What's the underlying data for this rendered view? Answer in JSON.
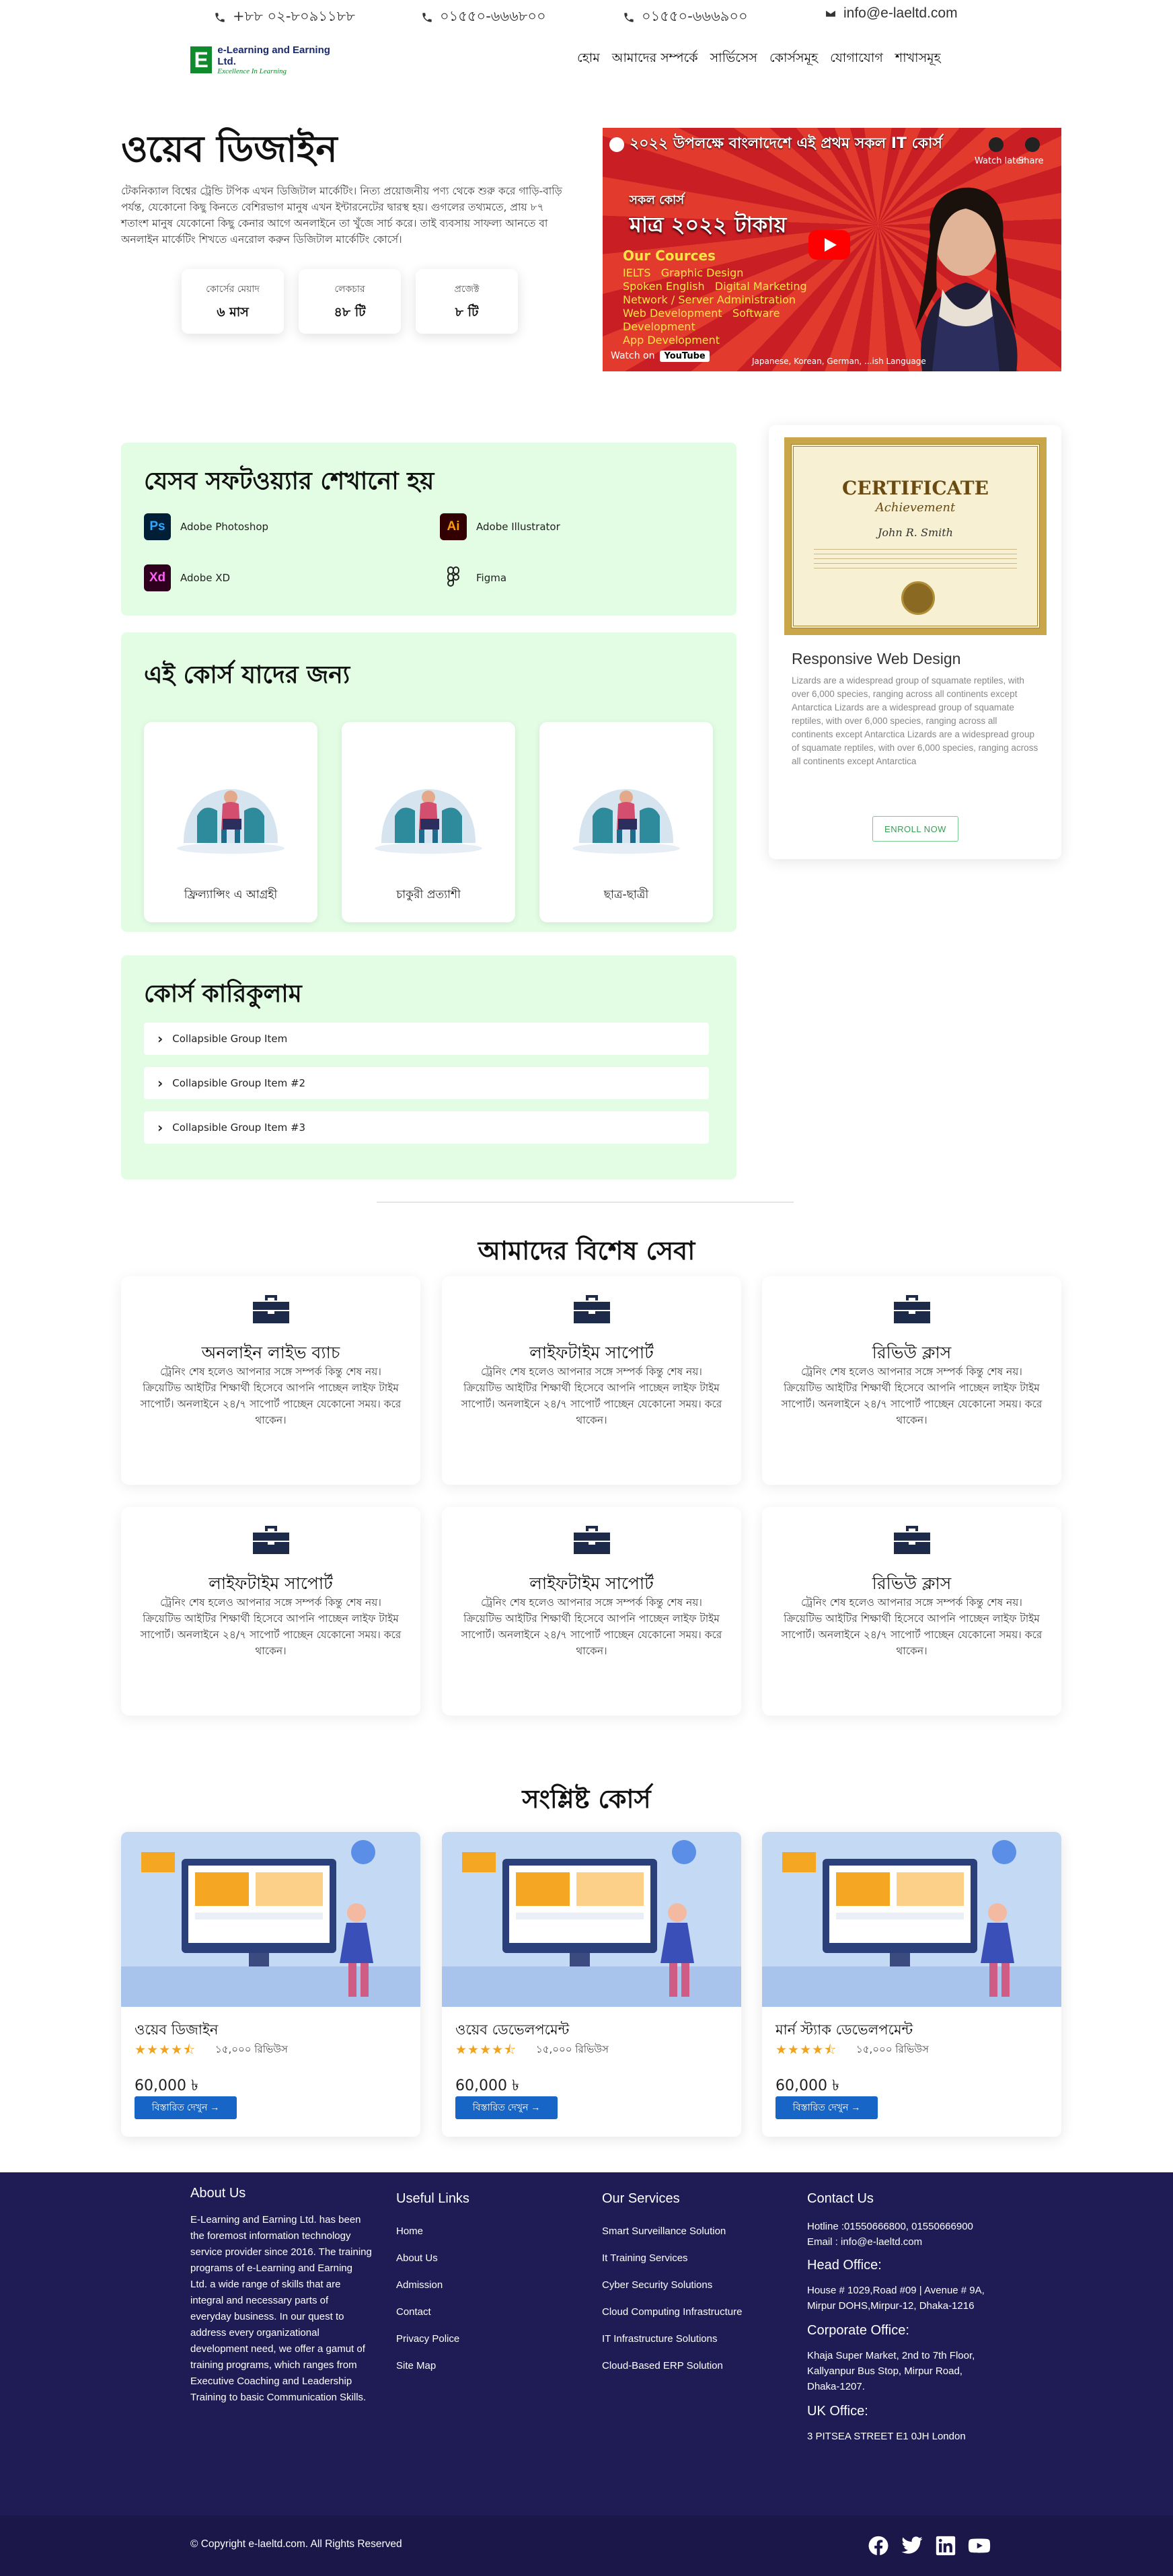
{
  "topbar": {
    "phone1": "+৮৮ ০২-৮০৯১১৮৮",
    "phone2": "০১৫৫০-৬৬৬৮০০",
    "phone3": "০১৫৫০-৬৬৬৯০০",
    "email": "info@e-laeltd.com"
  },
  "logo": {
    "mark": "E",
    "name": "e-Learning and Earning Ltd.",
    "tagline": "Excellence In Learning"
  },
  "nav": [
    "হোম",
    "আমাদের সম্পর্কে",
    "সার্ভিসেস",
    "কোর্সসমূহ",
    "যোগাযোগ",
    "শাখাসমূহ"
  ],
  "hero": {
    "title": "ওয়েব ডিজাইন",
    "description": "টেকনিক্যাল বিশ্বের ট্রেন্ডি টপিক এখন ডিজিটাল মার্কেটিং। নিত্য প্রয়োজনীয় পণ্য থেকে শুরু করে গাড়ি-বাড়ি পর্যন্ত, যেকোনো কিছু কিনতে বেশিরভাগ মানুষ এখন ইন্টারনেটের দ্বারস্থ হয়। গুগলের তথ্যমতে, প্রায় ৮৭ শতাংশ মানুষ যেকোনো কিছু কেনার আগে অনলাইনে তা খুঁজে সার্চ করে। তাই ব্যবসায় সাফল্য আনতে বা অনলাইন মার্কেটিং শিখতে এনরোল করুন ডিজিটাল মার্কেটিং কোর্সে।",
    "stats": [
      {
        "label": "কোর্সের মেয়াদ",
        "value": "৬ মাস"
      },
      {
        "label": "লেকচার",
        "value": "৪৮ টি"
      },
      {
        "label": "প্রজেক্ট",
        "value": "৮ টি"
      }
    ]
  },
  "video": {
    "title": "২০২২ উপলক্ষে বাংলাদেশে এই প্রথম সকল IT কোর্স",
    "watch_later": "Watch later",
    "share": "Share",
    "offer_line1": "সকল কোর্স",
    "offer_line2": "মাত্র ২০২২ টাকায়",
    "courses_heading": "Our Cources",
    "course_list": [
      "IELTS",
      "Graphic Design",
      "Spoken English",
      "Digital Marketing",
      "Network / Server Administration",
      "Web Development",
      "Software Development",
      "App Development"
    ],
    "watch_on": "Watch on",
    "youtube": "YouTube",
    "languages": "Japanese, Korean, German, ...ish Language"
  },
  "software": {
    "title": "যেসব সফটওয়্যার শেখানো হয়",
    "items": [
      {
        "icon": "Ps",
        "name": "Adobe Photoshop",
        "color": "#001e36"
      },
      {
        "icon": "Ai",
        "name": "Adobe Illustrator",
        "color": "#330000"
      },
      {
        "icon": "Xd",
        "name": "Adobe XD",
        "color": "#2e001e"
      },
      {
        "icon": "figma",
        "name": "Figma",
        "color": "#222222"
      }
    ]
  },
  "audience": {
    "title": "এই কোর্স যাদের জন্য",
    "items": [
      "ফ্রিল্যান্সিং এ আগ্রহী",
      "চাকুরী প্রত্যাশী",
      "ছাত্র-ছাত্রী"
    ]
  },
  "curriculum": {
    "title": "কোর্স কারিকুলাম",
    "items": [
      "Collapsible Group Item",
      "Collapsible Group Item #2",
      "Collapsible Group Item #3"
    ]
  },
  "certificate": {
    "cert_heading": "CERTIFICATE",
    "cert_sub": "Achievement",
    "cert_name": "John R. Smith",
    "title": "Responsive Web Design",
    "description": "Lizards are a widespread group of squamate reptiles, with over 6,000 species, ranging across all continents except Antarctica Lizards are a widespread group of squamate reptiles, with over 6,000 species, ranging across all continents except Antarctica Lizards are a widespread group of squamate reptiles, with over 6,000 species, ranging across all continents except Antarctica",
    "button": "ENROLL NOW"
  },
  "services": {
    "title": "আমাদের বিশেষ সেবা",
    "items": [
      {
        "title": "অনলাইন লাইভ ব্যাচ",
        "desc": "ট্রেনিং শেষ হলেও আপনার সঙ্গে সম্পর্ক কিন্তু শেষ নয়। ক্রিয়েটিভ আইটির শিক্ষার্থী হিসেবে আপনি পাচ্ছেন লাইফ টাইম সাপোর্ট। অনলাইনে ২৪/৭ সাপোর্ট পাচ্ছেন যেকোনো সময়। করে থাকেন।"
      },
      {
        "title": "লাইফটাইম সাপোর্ট",
        "desc": "ট্রেনিং শেষ হলেও আপনার সঙ্গে সম্পর্ক কিন্তু শেষ নয়। ক্রিয়েটিভ আইটির শিক্ষার্থী হিসেবে আপনি পাচ্ছেন লাইফ টাইম সাপোর্ট। অনলাইনে ২৪/৭ সাপোর্ট পাচ্ছেন যেকোনো সময়। করে থাকেন।"
      },
      {
        "title": "রিভিউ ক্লাস",
        "desc": "ট্রেনিং শেষ হলেও আপনার সঙ্গে সম্পর্ক কিন্তু শেষ নয়। ক্রিয়েটিভ আইটির শিক্ষার্থী হিসেবে আপনি পাচ্ছেন লাইফ টাইম সাপোর্ট। অনলাইনে ২৪/৭ সাপোর্ট পাচ্ছেন যেকোনো সময়। করে থাকেন।"
      },
      {
        "title": "লাইফটাইম সাপোর্ট",
        "desc": "ট্রেনিং শেষ হলেও আপনার সঙ্গে সম্পর্ক কিন্তু শেষ নয়। ক্রিয়েটিভ আইটির শিক্ষার্থী হিসেবে আপনি পাচ্ছেন লাইফ টাইম সাপোর্ট। অনলাইনে ২৪/৭ সাপোর্ট পাচ্ছেন যেকোনো সময়। করে থাকেন।"
      },
      {
        "title": "লাইফটাইম সাপোর্ট",
        "desc": "ট্রেনিং শেষ হলেও আপনার সঙ্গে সম্পর্ক কিন্তু শেষ নয়। ক্রিয়েটিভ আইটির শিক্ষার্থী হিসেবে আপনি পাচ্ছেন লাইফ টাইম সাপোর্ট। অনলাইনে ২৪/৭ সাপোর্ট পাচ্ছেন যেকোনো সময়। করে থাকেন।"
      },
      {
        "title": "রিভিউ ক্লাস",
        "desc": "ট্রেনিং শেষ হলেও আপনার সঙ্গে সম্পর্ক কিন্তু শেষ নয়। ক্রিয়েটিভ আইটির শিক্ষার্থী হিসেবে আপনি পাচ্ছেন লাইফ টাইম সাপোর্ট। অনলাইনে ২৪/৭ সাপোর্ট পাচ্ছেন যেকোনো সময়। করে থাকেন।"
      }
    ]
  },
  "related": {
    "title": "সংশ্লিষ্ট কোর্স",
    "items": [
      {
        "title": "ওয়েব ডিজাইন",
        "reviews": "১৫,০০০ রিভিউস",
        "price": "60,000 ৳",
        "button": "বিস্তারিত দেখুন →",
        "rating": 4.5
      },
      {
        "title": "ওয়েব ডেভেলপমেন্ট",
        "reviews": "১৫,০০০ রিভিউস",
        "price": "60,000 ৳",
        "button": "বিস্তারিত দেখুন →",
        "rating": 4.5
      },
      {
        "title": "মার্ন স্ট্যাক ডেভেলপমেন্ট",
        "reviews": "১৫,০০০ রিভিউস",
        "price": "60,000 ৳",
        "button": "বিস্তারিত দেখুন →",
        "rating": 4.5
      }
    ]
  },
  "footer": {
    "about_title": "About Us",
    "about_text": "E-Learning and Earning Ltd. has been the foremost information technology service provider since 2016. The training programs of e-Learning and Earning Ltd. a wide range of skills that are integral and necessary parts of everyday business. In our quest to address every organizational development need, we offer a gamut of training programs, which ranges from Executive Coaching and Leadership Training to basic Communication Skills.",
    "links_title": "Useful Links",
    "links": [
      "Home",
      "About Us",
      "Admission",
      "Contact",
      "Privacy Police",
      "Site Map"
    ],
    "services_title": "Our Services",
    "services": [
      "Smart Surveillance Solution",
      "It Training Services",
      "Cyber Security Solutions",
      "Cloud Computing Infrastructure",
      "IT Infrastructure Solutions",
      "Cloud-Based ERP Solution"
    ],
    "contact_title": "Contact Us",
    "hotline": "Hotline :01550666800, 01550666900 Email : info@e-laeltd.com",
    "head_office_title": "Head Office:",
    "head_office": "House # 1029,Road #09 | Avenue # 9A, Mirpur DOHS,Mirpur-12, Dhaka-1216",
    "corporate_title": "Corporate Office:",
    "corporate": "Khaja Super Market, 2nd to 7th Floor, Kallyanpur Bus Stop, Mirpur Road, Dhaka-1207.",
    "uk_title": "UK Office:",
    "uk": "3 PITSEA STREET E1 0JH London"
  },
  "copyright": "© Copyright e-laeltd.com. All Rights Reserved",
  "social": [
    "facebook-icon",
    "twitter-icon",
    "linkedin-icon",
    "youtube-icon"
  ],
  "colors": {
    "panel": "#e2fde3",
    "footer": "#1e1b55",
    "accent": "#1665c7",
    "star": "#f1a31d",
    "logo_green": "#0f8a2c"
  }
}
